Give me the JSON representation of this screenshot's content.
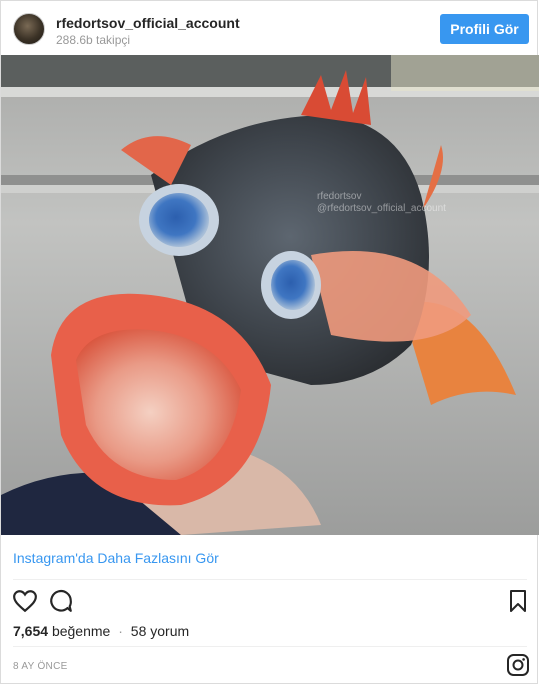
{
  "header": {
    "username": "rfedortsov_official_account",
    "followers": "288.6b takipçi",
    "profile_button": "Profili Gör"
  },
  "photo": {
    "watermark_line1": "rfedortsov",
    "watermark_line2": "@rfedortsov_official_account"
  },
  "more_link": "Instagram'da Daha Fazlasını Gör",
  "stats": {
    "likes_count": "7,654",
    "likes_word": "beğenme",
    "separator": "·",
    "comments": "58 yorum"
  },
  "time_ago": "8 AY ÖNCE",
  "icons": {
    "like": "heart-icon",
    "comment": "comment-icon",
    "save": "bookmark-icon",
    "brand": "instagram-icon"
  },
  "colors": {
    "accent": "#3897f0",
    "text": "#262626",
    "muted": "#999999"
  }
}
